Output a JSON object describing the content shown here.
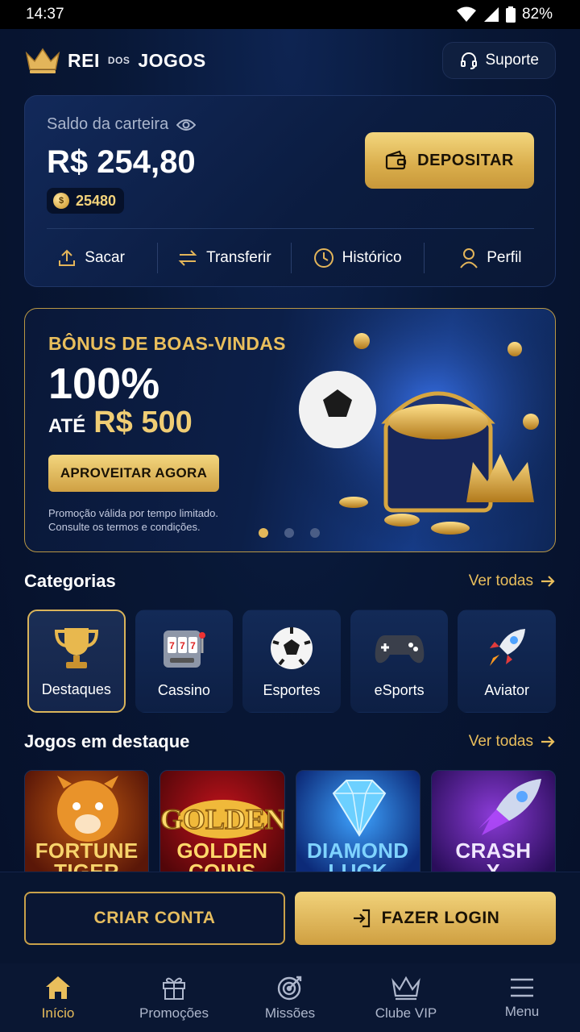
{
  "status_bar": {
    "time": "14:37",
    "battery": "82%"
  },
  "header": {
    "logo": {
      "word1": "REI",
      "word2": "DOS",
      "word3": "JOGOS"
    },
    "support_label": "Suporte"
  },
  "wallet": {
    "label": "Saldo da carteira",
    "balance": "R$ 254,80",
    "coins": "25480",
    "deposit_label": "DEPOSITAR",
    "actions": [
      {
        "label": "Sacar",
        "icon": "upload-icon"
      },
      {
        "label": "Transferir",
        "icon": "transfer-icon"
      },
      {
        "label": "Histórico",
        "icon": "clock-icon"
      },
      {
        "label": "Perfil",
        "icon": "user-icon"
      }
    ]
  },
  "banner": {
    "kicker": "BÔNUS DE BOAS-VINDAS",
    "headline": "100%",
    "upto_label": "ATÉ",
    "amount": "R$ 500",
    "cta_label": "APROVEITAR AGORA",
    "terms_line1": "Promoção válida por tempo limitado.",
    "terms_line2": "Consulte os termos e condições.",
    "active_slide": 1,
    "slide_count": 3
  },
  "categories": {
    "title": "Categorias",
    "see_all": "Ver todas",
    "items": [
      {
        "label": "Destaques",
        "icon": "trophy-icon",
        "active": true
      },
      {
        "label": "Cassino",
        "icon": "slot-machine-icon"
      },
      {
        "label": "Esportes",
        "icon": "soccer-ball-icon"
      },
      {
        "label": "eSports",
        "icon": "gamepad-icon"
      },
      {
        "label": "Aviator",
        "icon": "rocket-icon"
      }
    ]
  },
  "featured": {
    "title": "Jogos em destaque",
    "see_all": "Ver todas",
    "games": [
      {
        "line1": "FORTUNE",
        "line2": "TIGER"
      },
      {
        "line1": "GOLDEN",
        "line2": "COINS"
      },
      {
        "line1": "DIAMOND",
        "line2": "LUCK"
      },
      {
        "line1": "CRASH",
        "line2": "X"
      }
    ]
  },
  "auth": {
    "create_label": "CRIAR CONTA",
    "login_label": "FAZER LOGIN"
  },
  "tabbar": {
    "items": [
      {
        "label": "Início",
        "icon": "home-icon",
        "active": true
      },
      {
        "label": "Promoções",
        "icon": "gift-icon"
      },
      {
        "label": "Missões",
        "icon": "target-icon"
      },
      {
        "label": "Clube VIP",
        "icon": "crown-icon"
      },
      {
        "label": "Menu",
        "icon": "menu-icon"
      }
    ]
  },
  "colors": {
    "accent_gold": "#e9be5c",
    "background": "#07142e",
    "card": "#0f2451"
  }
}
